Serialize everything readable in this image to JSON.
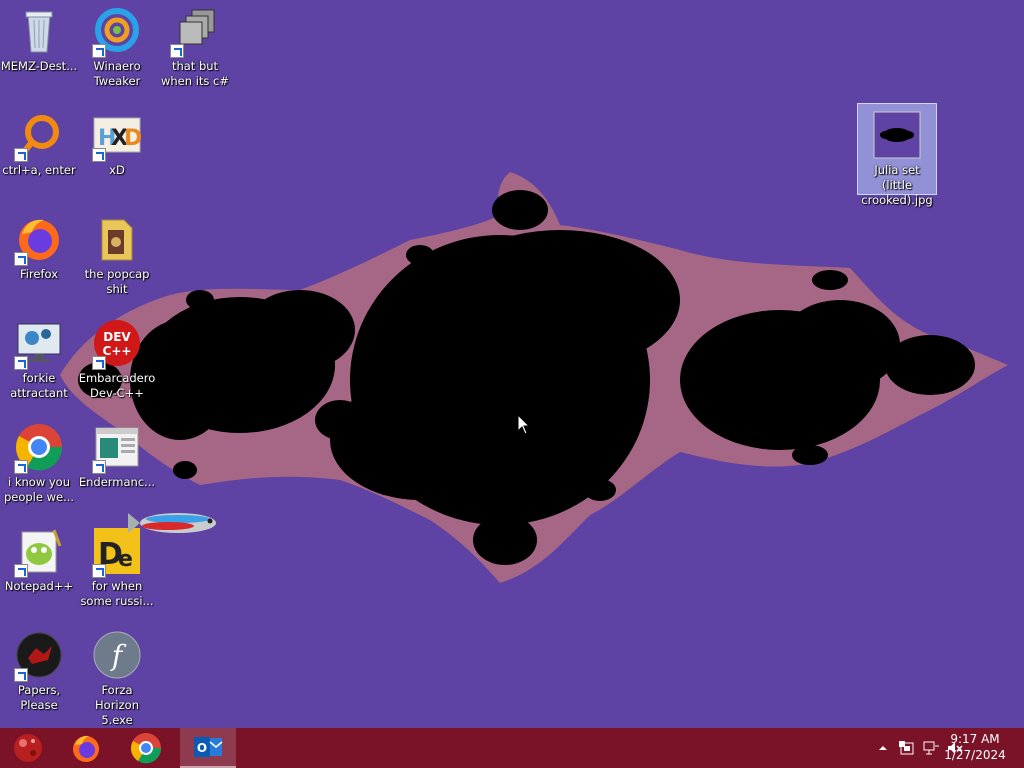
{
  "desktop": {
    "wallpaper_color": "#5e43a4",
    "icons": [
      {
        "label": "MEMZ-Dest...",
        "icon": "recycle-bin-icon",
        "shortcut": false,
        "selected": false
      },
      {
        "label": "Winaero Tweaker",
        "icon": "winaero-tweaker-icon",
        "shortcut": true,
        "selected": false
      },
      {
        "label": "that but when its c#",
        "icon": "stacked-windows-icon",
        "shortcut": true,
        "selected": false
      },
      {
        "label": "ctrl+a, enter",
        "icon": "orange-ring-icon",
        "shortcut": true,
        "selected": false
      },
      {
        "label": "xD",
        "icon": "hxd-editor-icon",
        "shortcut": true,
        "selected": false
      },
      {
        "label": "Firefox",
        "icon": "firefox-icon",
        "shortcut": true,
        "selected": false
      },
      {
        "label": "the popcap shit",
        "icon": "folder-icon",
        "shortcut": false,
        "selected": false
      },
      {
        "label": "forkie attractant",
        "icon": "monitor-gear-icon",
        "shortcut": true,
        "selected": false
      },
      {
        "label": "Embarcadero Dev-C++",
        "icon": "dev-cpp-icon",
        "shortcut": true,
        "selected": false
      },
      {
        "label": "i know you people we...",
        "icon": "chrome-icon",
        "shortcut": true,
        "selected": false
      },
      {
        "label": "Endermanc...",
        "icon": "window-app-icon",
        "shortcut": true,
        "selected": false
      },
      {
        "label": "Notepad++",
        "icon": "notepad-plus-plus-icon",
        "shortcut": true,
        "selected": false
      },
      {
        "label": "for when some russi...",
        "icon": "de-app-icon",
        "shortcut": true,
        "selected": false
      },
      {
        "label": "Papers, Please",
        "icon": "papers-please-icon",
        "shortcut": true,
        "selected": false
      },
      {
        "label": "Forza Horizon 5.exe",
        "icon": "flash-icon",
        "shortcut": false,
        "selected": false
      },
      {
        "label": "Julia set (little crooked).jpg",
        "icon": "image-thumbnail-icon",
        "shortcut": false,
        "selected": true
      }
    ]
  },
  "taskbar": {
    "color": "#7a1228",
    "buttons": [
      {
        "name": "start-button",
        "icon": "start-orb-icon"
      },
      {
        "name": "firefox-taskbar-button",
        "icon": "firefox-icon"
      },
      {
        "name": "chrome-taskbar-button",
        "icon": "chrome-icon"
      },
      {
        "name": "outlook-taskbar-button",
        "icon": "outlook-icon"
      }
    ],
    "tray": {
      "icons": [
        "show-hidden-icons-chevron-icon",
        "action-center-icon",
        "network-icon",
        "volume-muted-icon"
      ]
    },
    "clock": {
      "time": "9:17 AM",
      "date": "1/27/2024"
    }
  }
}
